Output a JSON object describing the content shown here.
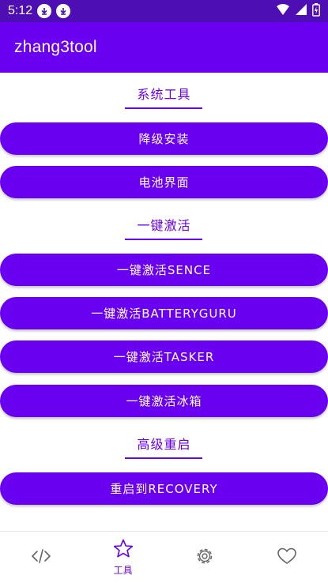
{
  "status_bar": {
    "time": "5:12",
    "icons": [
      "download-icon",
      "download-icon",
      "wifi-icon",
      "signal-icon",
      "battery-charging-icon"
    ]
  },
  "app_bar": {
    "title": "zhang3tool"
  },
  "sections": [
    {
      "title": "系统工具",
      "buttons": [
        "降级安装",
        "电池界面"
      ]
    },
    {
      "title": "一键激活",
      "buttons": [
        "一键激活SENCE",
        "一键激活BATTERYGURU",
        "一键激活TASKER",
        "一键激活冰箱"
      ]
    },
    {
      "title": "高级重启",
      "buttons": [
        "重启到RECOVERY"
      ]
    }
  ],
  "bottom_nav": [
    {
      "icon": "code-icon",
      "label": "",
      "active": false
    },
    {
      "icon": "star-icon",
      "label": "工具",
      "active": true
    },
    {
      "icon": "gear-icon",
      "label": "",
      "active": false
    },
    {
      "icon": "heart-icon",
      "label": "",
      "active": false
    }
  ],
  "colors": {
    "primary": "#6a00f0",
    "status_bar": "#4d0fb3",
    "nav_inactive": "#666666"
  }
}
